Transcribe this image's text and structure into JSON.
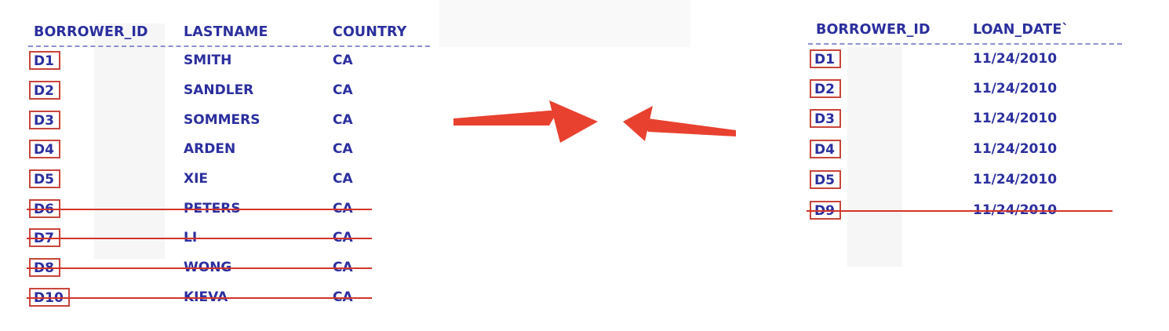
{
  "left_table": {
    "headers": [
      "BORROWER_ID",
      "LASTNAME",
      "COUNTRY"
    ],
    "rows": [
      {
        "id": "D1",
        "lastname": "SMITH",
        "country": "CA",
        "struck": false
      },
      {
        "id": "D2",
        "lastname": "SANDLER",
        "country": "CA",
        "struck": false
      },
      {
        "id": "D3",
        "lastname": "SOMMERS",
        "country": "CA",
        "struck": false
      },
      {
        "id": "D4",
        "lastname": "ARDEN",
        "country": "CA",
        "struck": false
      },
      {
        "id": "D5",
        "lastname": "XIE",
        "country": "CA",
        "struck": false
      },
      {
        "id": "D6",
        "lastname": "PETERS",
        "country": "CA",
        "struck": true
      },
      {
        "id": "D7",
        "lastname": "LI",
        "country": "CA",
        "struck": true
      },
      {
        "id": "D8",
        "lastname": "WONG",
        "country": "CA",
        "struck": true
      },
      {
        "id": "D10",
        "lastname": "KIEVA",
        "country": "CA",
        "struck": true
      }
    ]
  },
  "right_table": {
    "headers": [
      "BORROWER_ID",
      "LOAN_DATE`"
    ],
    "rows": [
      {
        "id": "D1",
        "loan_date": "11/24/2010",
        "struck": false
      },
      {
        "id": "D2",
        "loan_date": "11/24/2010",
        "struck": false
      },
      {
        "id": "D3",
        "loan_date": "11/24/2010",
        "struck": false
      },
      {
        "id": "D4",
        "loan_date": "11/24/2010",
        "struck": false
      },
      {
        "id": "D5",
        "loan_date": "11/24/2010",
        "struck": false
      },
      {
        "id": "D9",
        "loan_date": "11/24/2010",
        "struck": true
      }
    ]
  },
  "colors": {
    "text": "#2b2f9e",
    "box": "#c8453b",
    "strike": "#d4342a",
    "arrow": "#e8412f"
  }
}
